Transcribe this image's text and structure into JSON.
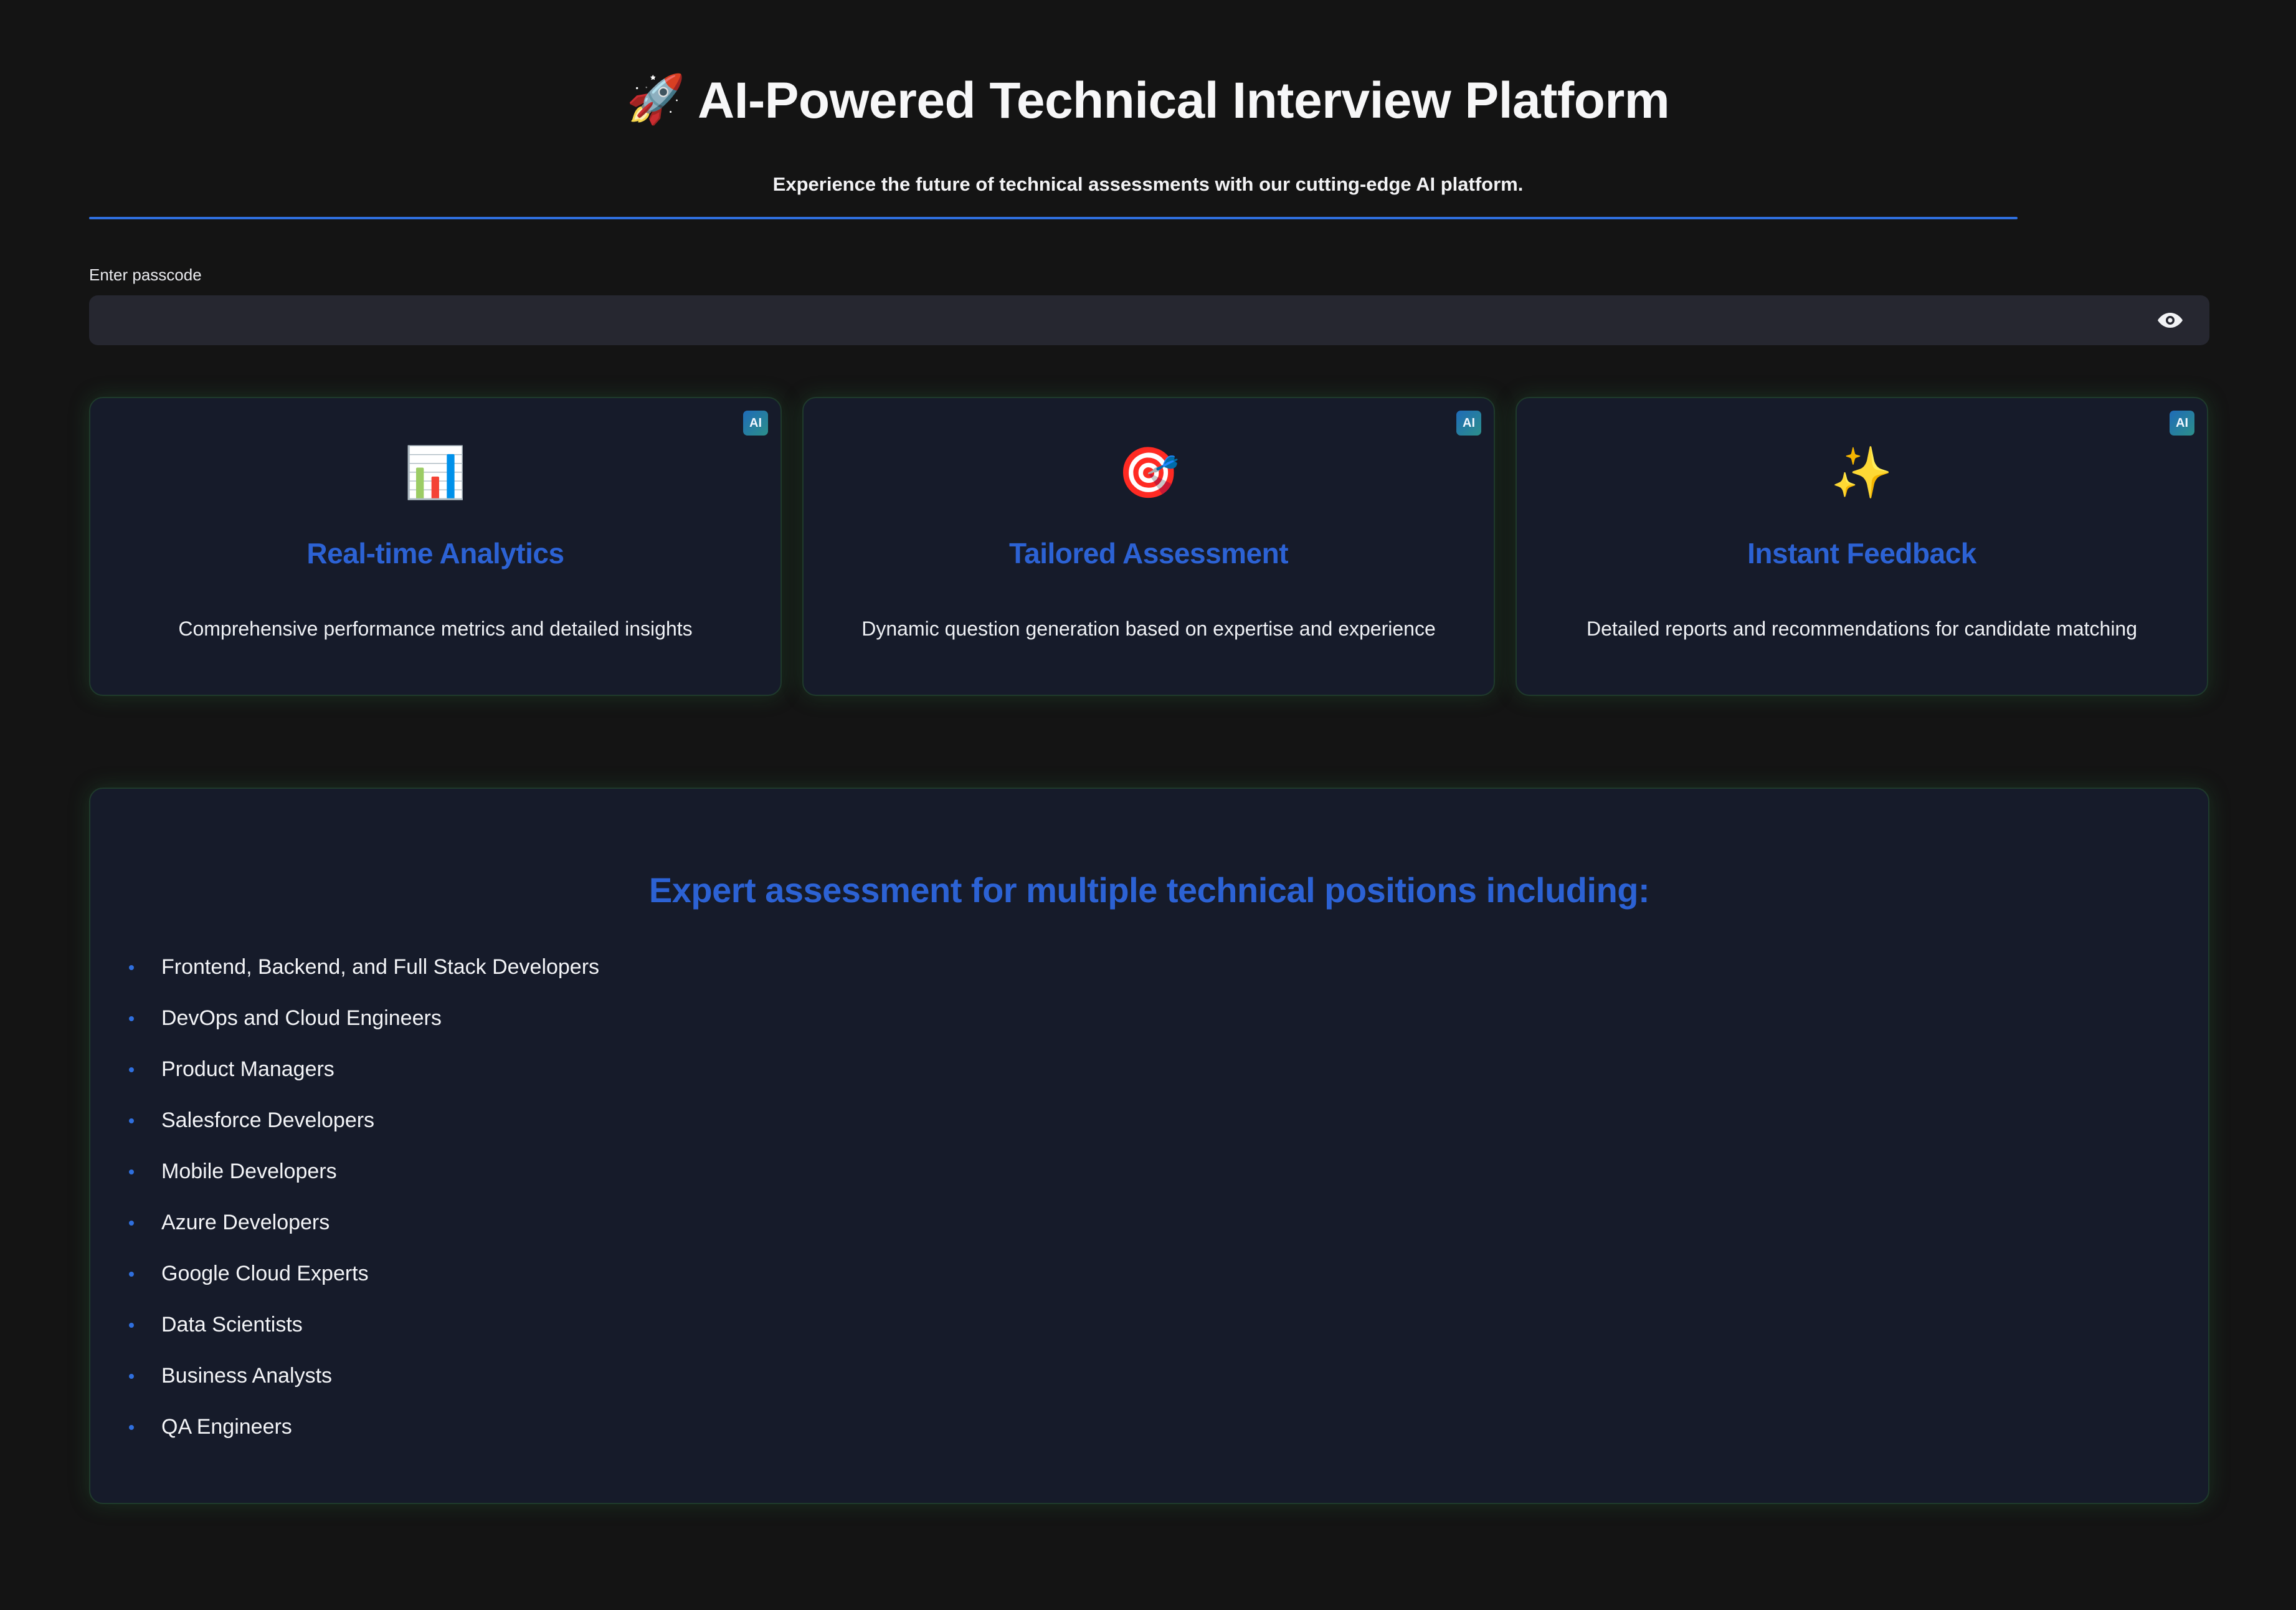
{
  "header": {
    "title_icon": "🚀",
    "title": "AI-Powered Technical Interview Platform",
    "subtitle": "Experience the future of technical assessments with our cutting-edge AI platform."
  },
  "passcode": {
    "label": "Enter passcode",
    "value": "",
    "placeholder": "",
    "toggle_icon": "eye-icon"
  },
  "features": [
    {
      "badge": "AI",
      "icon": "📊",
      "icon_name": "bar-chart-icon",
      "title": "Real-time Analytics",
      "description": "Comprehensive performance metrics and detailed insights"
    },
    {
      "badge": "AI",
      "icon": "🎯",
      "icon_name": "target-icon",
      "title": "Tailored Assessment",
      "description": "Dynamic question generation based on expertise and experience"
    },
    {
      "badge": "AI",
      "icon": "✨",
      "icon_name": "sparkles-icon",
      "title": "Instant Feedback",
      "description": "Detailed reports and recommendations for candidate matching"
    }
  ],
  "positions": {
    "heading": "Expert assessment for multiple technical positions including:",
    "items": [
      "Frontend, Backend, and Full Stack Developers",
      "DevOps and Cloud Engineers",
      "Product Managers",
      "Salesforce Developers",
      "Mobile Developers",
      "Azure Developers",
      "Google Cloud Experts",
      "Data Scientists",
      "Business Analysts",
      "QA Engineers"
    ]
  },
  "colors": {
    "background": "#141414",
    "accent": "#2c62d4",
    "divider": "#2f6fde",
    "card_background": "#161b2a",
    "card_border_glow": "#2e8246"
  }
}
